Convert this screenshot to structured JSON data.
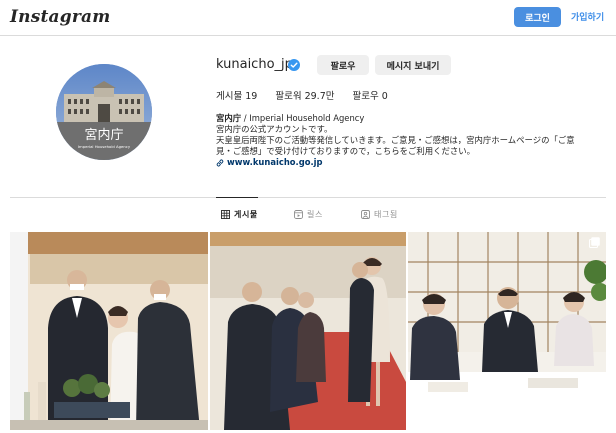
{
  "header": {
    "logo": "Instagram",
    "login_label": "로그인",
    "signup_label": "가입하기"
  },
  "profile": {
    "username": "kunaicho_jp",
    "verified": true,
    "follow_label": "팔로우",
    "message_label": "메시지 보내기",
    "stats": {
      "posts": "게시물 19",
      "followers": "팔로워 29.7만",
      "following": "팔로우 0"
    },
    "avatar": {
      "title": "宮内庁",
      "subtitle": "Imperial Household Agency"
    },
    "bio": {
      "name": "宮内庁",
      "name_suffix": " / Imperial Household Agency",
      "lines": [
        "宮内庁の公式アカウントです。",
        "天皇皇后両陛下のご活動等発信していきます。ご意見・ご感想は，宮内庁ホームページの「ご意",
        "見・ご感想」で受け付けておりますので，こちらをご利用ください。"
      ],
      "link": "www.kunaicho.go.jp"
    }
  },
  "tabs": [
    {
      "label": "게시물",
      "icon": "grid-icon",
      "active": true
    },
    {
      "label": "릴스",
      "icon": "reels-icon",
      "active": false
    },
    {
      "label": "태그됨",
      "icon": "tagged-icon",
      "active": false
    }
  ],
  "posts": [
    {
      "id": "post-1",
      "icon": "carousel-icon"
    },
    {
      "id": "post-2",
      "icon": "carousel-icon"
    },
    {
      "id": "post-3",
      "icon": "carousel-icon"
    }
  ],
  "colors": {
    "accent": "#4a8fe0",
    "link": "#00376b",
    "verified": "#3897f0",
    "button_bg": "#efefef",
    "border": "#dbdbdb"
  }
}
